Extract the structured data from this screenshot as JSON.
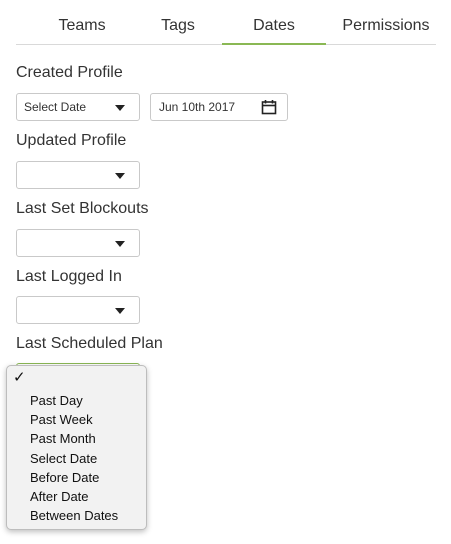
{
  "tabs": [
    {
      "label": "Teams"
    },
    {
      "label": "Tags"
    },
    {
      "label": "Dates",
      "active": true
    },
    {
      "label": "Permissions"
    }
  ],
  "accent_color": "#8ab854",
  "fields": {
    "created_profile": {
      "label": "Created Profile",
      "select_value": "Select Date",
      "date_value": "Jun 10th 2017"
    },
    "updated_profile": {
      "label": "Updated Profile",
      "select_value": ""
    },
    "last_set_blockouts": {
      "label": "Last Set Blockouts",
      "select_value": ""
    },
    "last_logged_in": {
      "label": "Last Logged In",
      "select_value": ""
    },
    "last_scheduled_plan": {
      "label": "Last Scheduled Plan",
      "select_value": ""
    }
  },
  "dropdown": {
    "checkmark": "✓",
    "options": [
      "Past Day",
      "Past Week",
      "Past Month",
      "Select Date",
      "Before Date",
      "After Date",
      "Between Dates"
    ]
  },
  "icons": {
    "date_input": "calendar-icon",
    "select": "caret-down-icon"
  }
}
